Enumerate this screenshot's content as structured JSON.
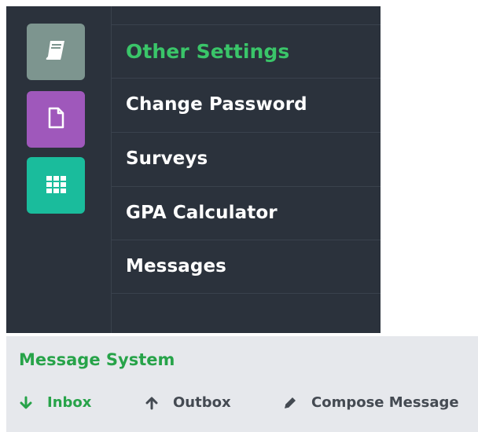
{
  "sidebar": {
    "icons": [
      {
        "name": "book-icon",
        "color": "#7d958f"
      },
      {
        "name": "document-icon",
        "color": "#9f58bb"
      },
      {
        "name": "grid-icon",
        "color": "#1abc9c"
      }
    ],
    "menu": [
      {
        "label": "Other Settings",
        "active": true
      },
      {
        "label": "Change Password",
        "active": false
      },
      {
        "label": "Surveys",
        "active": false
      },
      {
        "label": "GPA Calculator",
        "active": false
      },
      {
        "label": "Messages",
        "active": false
      }
    ]
  },
  "message_system": {
    "title": "Message System",
    "tabs": [
      {
        "label": "Inbox",
        "icon": "arrow-down-icon",
        "active": true
      },
      {
        "label": "Outbox",
        "icon": "arrow-up-icon",
        "active": false
      },
      {
        "label": "Compose Message",
        "icon": "pencil-icon",
        "active": false
      }
    ]
  },
  "colors": {
    "nav_background": "#2b323c",
    "accent_green": "#3ac569",
    "panel_background": "#e6e8ec"
  }
}
